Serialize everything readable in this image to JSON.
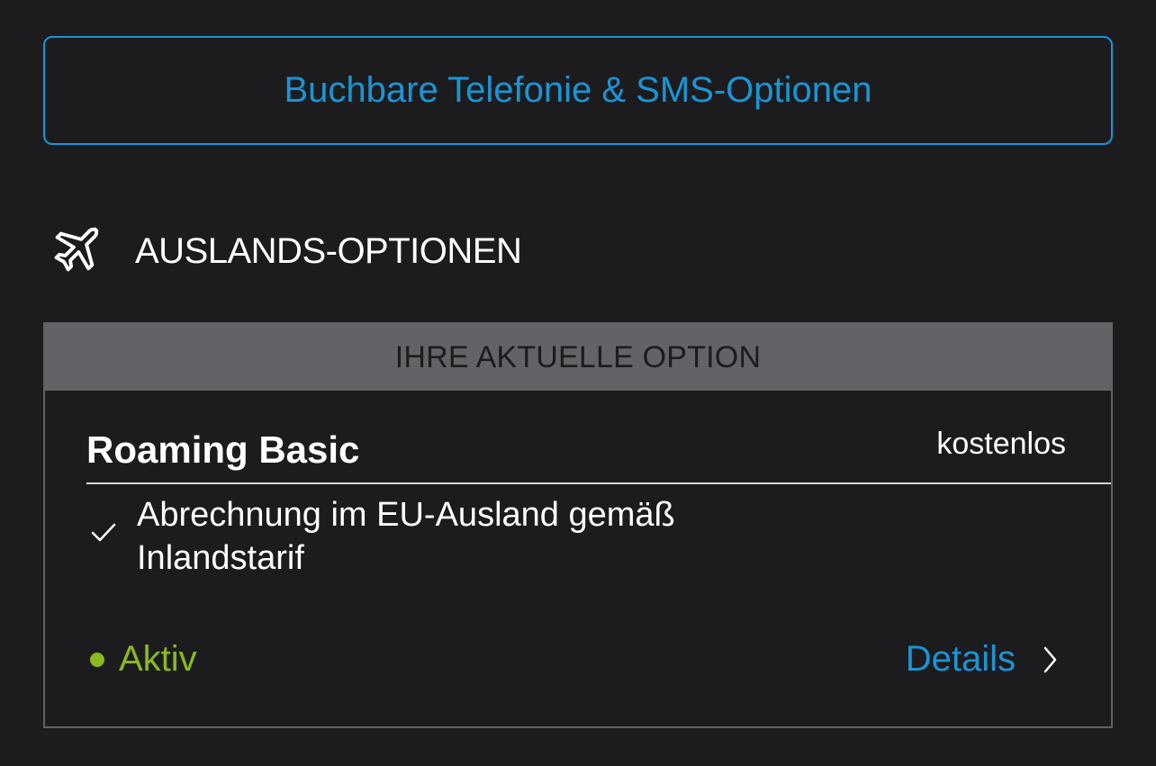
{
  "book_button": {
    "label": "Buchbare Telefonie & SMS-Optionen"
  },
  "section": {
    "icon": "airplane-icon",
    "title": "AUSLANDS-OPTIONEN"
  },
  "current_option": {
    "banner": "IHRE AKTUELLE OPTION",
    "name": "Roaming Basic",
    "price": "kostenlos",
    "features": [
      {
        "icon": "checkmark-icon",
        "text": "Abrechnung im EU-Ausland gemäß Inlandstarif"
      }
    ],
    "status": "Aktiv",
    "details_label": "Details"
  },
  "colors": {
    "background": "#1c1c1e",
    "accent": "#1a95d6",
    "active": "#8ab921",
    "banner": "#636367"
  }
}
